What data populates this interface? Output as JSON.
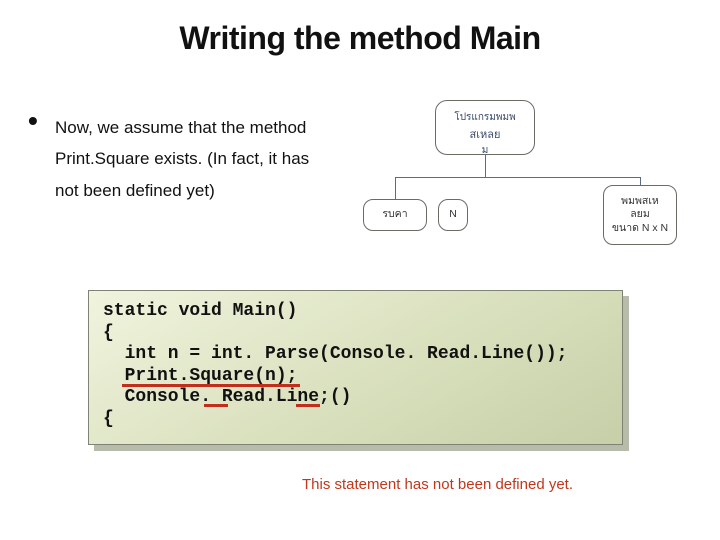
{
  "title": "Writing the method Main",
  "bullet": "•",
  "body": "Now, we assume that the method  Print.Square exists. (In fact, it has not been defined yet)",
  "diagram": {
    "top": {
      "l1": "โปรแกรมพมพ",
      "l2": "สเหลย",
      "l3": "ม"
    },
    "left": "รบคา",
    "mid": "N",
    "right": "พมพสเห\nลยม\nขนาด N x N"
  },
  "code": "static void Main()\n{\n  int n = int. Parse(Console. Read.Line());\n  Print.Square(n);\n  Console. Read.Line;()\n{",
  "caption": "This statement has not been defined yet."
}
